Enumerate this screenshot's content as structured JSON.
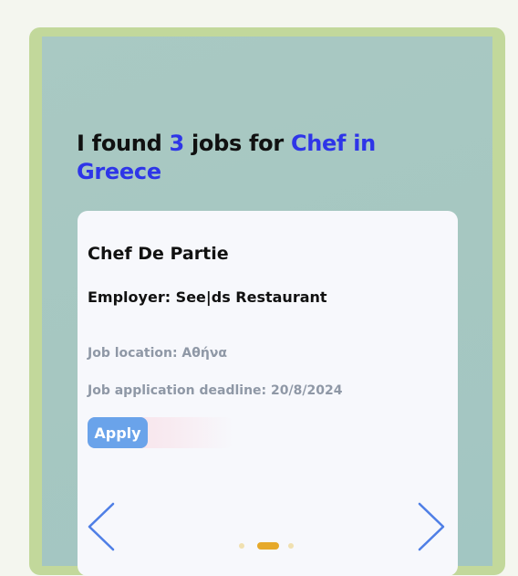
{
  "results": {
    "prefix": "I found ",
    "count": "3",
    "middle": " jobs for ",
    "query": "Chef in Greece"
  },
  "job": {
    "title": "Chef De Partie",
    "employer": "Employer: See|ds Restaurant",
    "location": "Job location: Αθήνα",
    "deadline": "Job application deadline: 20/8/2024",
    "apply_label": "Apply"
  },
  "carousel": {
    "prev_icon": "chevron-left-icon",
    "next_icon": "chevron-right-icon",
    "active_dot": 2,
    "dot_count": 3
  },
  "colors": {
    "highlight": "#2e35e8",
    "apply_button": "#6aa3ea",
    "arrow": "#4f7fe6",
    "active_dot": "#e6a92a",
    "frame": "#c2d89b"
  }
}
